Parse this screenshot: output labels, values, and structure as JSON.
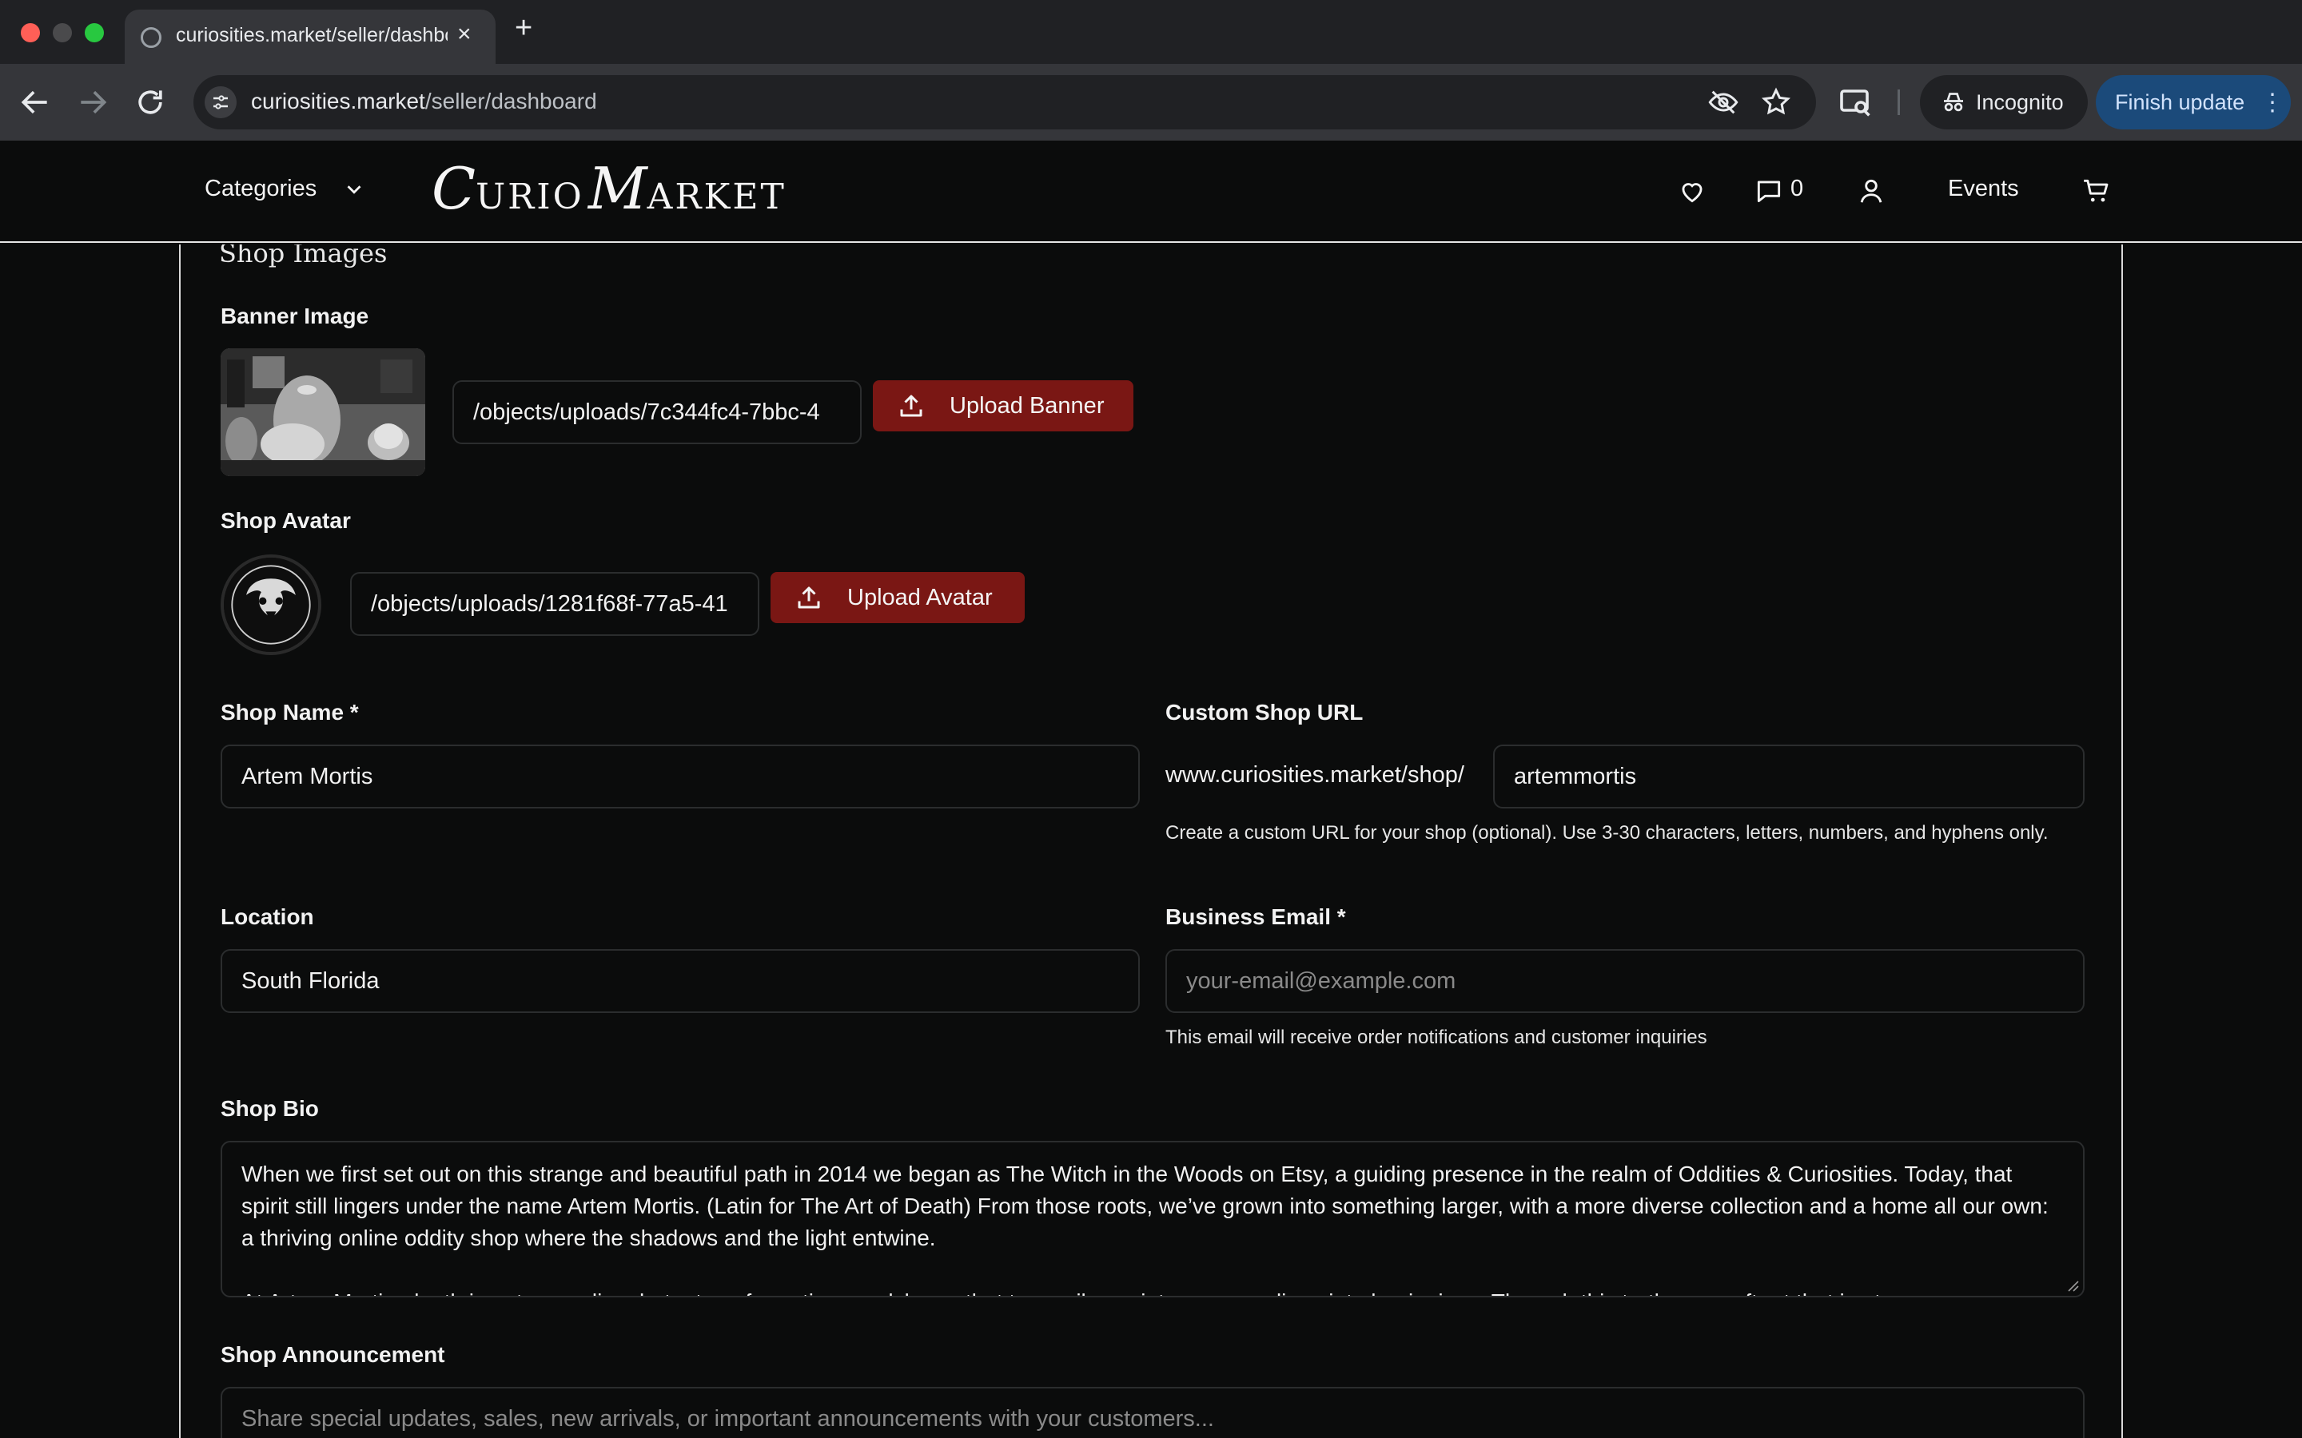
{
  "browser": {
    "tab_title": "curiosities.market/seller/dashboard",
    "url_host": "curiosities.market",
    "url_path": "/seller/dashboard",
    "incognito_label": "Incognito",
    "finish_update_label": "Finish update"
  },
  "header": {
    "categories_label": "Categories",
    "logo": {
      "c": "C",
      "urio": "URIO",
      "m": "M",
      "arket": "ARKET"
    },
    "messages_count": "0",
    "events_label": "Events"
  },
  "shop_images": {
    "section_title": "Shop Images",
    "banner_label": "Banner Image",
    "banner_path": "/objects/uploads/7c344fc4-7bbc-4",
    "banner_button": "Upload Banner",
    "avatar_label": "Shop Avatar",
    "avatar_path": "/objects/uploads/1281f68f-77a5-41",
    "avatar_button": "Upload Avatar"
  },
  "form": {
    "shop_name_label": "Shop Name *",
    "shop_name_value": "Artem Mortis",
    "custom_url_label": "Custom Shop URL",
    "custom_url_prefix": "www.curiosities.market/shop/",
    "custom_url_value": "artemmortis",
    "custom_url_help": "Create a custom URL for your shop (optional). Use 3-30 characters, letters, numbers, and hyphens only.",
    "location_label": "Location",
    "location_value": "South Florida",
    "email_label": "Business Email *",
    "email_placeholder": "your-email@example.com",
    "email_help": "This email will receive order notifications and customer inquiries",
    "bio_label": "Shop Bio",
    "bio_paragraph_1": "When we first set out on this strange and beautiful path in 2014 we began as The Witch in the Woods on Etsy, a guiding presence in the realm of Oddities & Curiosities. Today, that spirit still lingers under the name Artem Mortis. (Latin for The Art of Death) From those roots, we’ve grown into something larger, with a more diverse collection and a home all our own: a thriving online oddity shop where the shadows and the light entwine.",
    "bio_paragraph_2": "At Artem Mortis, death is not an ending, but a transformation an alchemy that turns silence into song, endings into beginnings. Through this truth, we craft art that is at once",
    "announcement_label": "Shop Announcement",
    "announcement_placeholder": "Share special updates, sales, new arrivals, or important announcements with your customers..."
  },
  "colors": {
    "page_bg": "#0b0c0c",
    "accent_button": "#7a1714",
    "field_border": "#2b2d2e",
    "chrome_bg": "#35363a",
    "finish_update_bg": "#1b4a7a"
  }
}
